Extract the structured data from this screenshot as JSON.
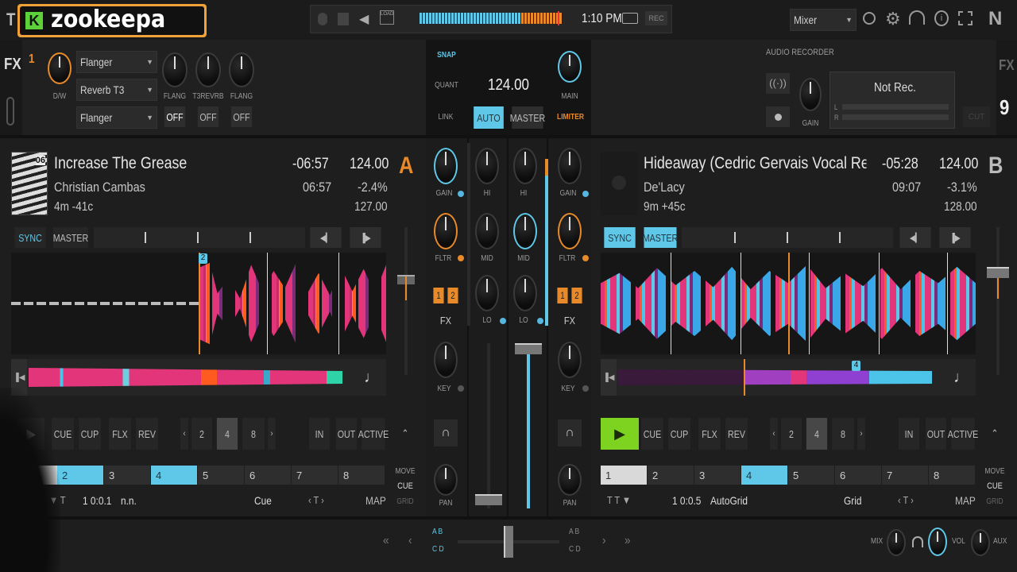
{
  "top": {
    "logo": "zookeepa",
    "logo_badge": "K",
    "clock": "1:10 PM",
    "rec": "REC",
    "load": "LOAD",
    "layout": "Mixer",
    "logo_right": "N",
    "left_letter": "T"
  },
  "fx": {
    "label": "FX",
    "right_label": "FX",
    "unit": "1",
    "right_unit": "9",
    "dw": "D/W",
    "slots": [
      "Flanger",
      "Reverb T3",
      "Flanger"
    ],
    "knob_labels": [
      "FLANG",
      "T3REVRB",
      "FLANG"
    ],
    "switches": [
      "OFF",
      "OFF",
      "OFF"
    ]
  },
  "master": {
    "snap": "SNAP",
    "quant": "QUANT",
    "bpm": "124.00",
    "link": "LINK",
    "auto": "AUTO",
    "master_btn": "MASTER",
    "main": "MAIN",
    "limiter": "LIMITER"
  },
  "recorder": {
    "title": "AUDIO RECORDER",
    "status": "Not Rec.",
    "gain": "GAIN",
    "l": "L",
    "r": "R",
    "cut": "CUT"
  },
  "deckA": {
    "title": "Increase The Grease",
    "artist": "Christian Cambas",
    "key": "4m -41c",
    "remaining": "-06:57",
    "elapsed": "06:57",
    "bpm": "124.00",
    "pitch": "-2.4%",
    "orig_bpm": "127.00",
    "letter": "A",
    "sync": "SYNC",
    "master": "MASTER",
    "cue_num1": "2",
    "cue_num2": "4",
    "transport": [
      "CUE",
      "CUP",
      "FLX",
      "REV"
    ],
    "loops": [
      "2",
      "4",
      "8"
    ],
    "loop_btns": [
      "IN",
      "OUT",
      "ACTIVE"
    ],
    "hotcues": [
      "1",
      "2",
      "3",
      "4",
      "5",
      "6",
      "7",
      "8"
    ],
    "move": "MOVE",
    "cue_mode": "CUE",
    "grid": "GRID",
    "position": "1 0:0.1",
    "name": "n.n.",
    "type": "Cue",
    "map": "MAP",
    "art_text": "06"
  },
  "deckB": {
    "title": "Hideaway (Cedric Gervais Vocal Remix) ht",
    "artist": "De'Lacy",
    "key": "9m +45c",
    "remaining": "-05:28",
    "elapsed": "09:07",
    "bpm": "124.00",
    "pitch": "-3.1%",
    "orig_bpm": "128.00",
    "letter": "B",
    "sync": "SYNC",
    "master": "MASTER",
    "cue_num1": "4",
    "transport": [
      "CUE",
      "CUP",
      "FLX",
      "REV"
    ],
    "loops": [
      "2",
      "4",
      "8"
    ],
    "loop_btns": [
      "IN",
      "OUT",
      "ACTIVE"
    ],
    "hotcues": [
      "1",
      "2",
      "3",
      "4",
      "5",
      "6",
      "7",
      "8"
    ],
    "move": "MOVE",
    "cue_mode": "CUE",
    "grid": "GRID",
    "position": "1 0:0.5",
    "name": "AutoGrid",
    "type": "Grid",
    "map": "MAP"
  },
  "mixer": {
    "gain": "GAIN",
    "hi": "HI",
    "mid": "MID",
    "lo": "LO",
    "fltr": "FLTR",
    "fx": "FX",
    "fx1": "1",
    "fx2": "2",
    "key": "KEY",
    "pan": "PAN"
  },
  "bottom": {
    "ab": "A B",
    "cd": "C D",
    "mix": "MIX",
    "vol": "VOL",
    "aux": "AUX"
  },
  "colors": {
    "accent_blue": "#5fc8e8",
    "accent_orange": "#e88a2a",
    "play_green": "#7ed321",
    "waveform_pink": "#e2357a"
  }
}
